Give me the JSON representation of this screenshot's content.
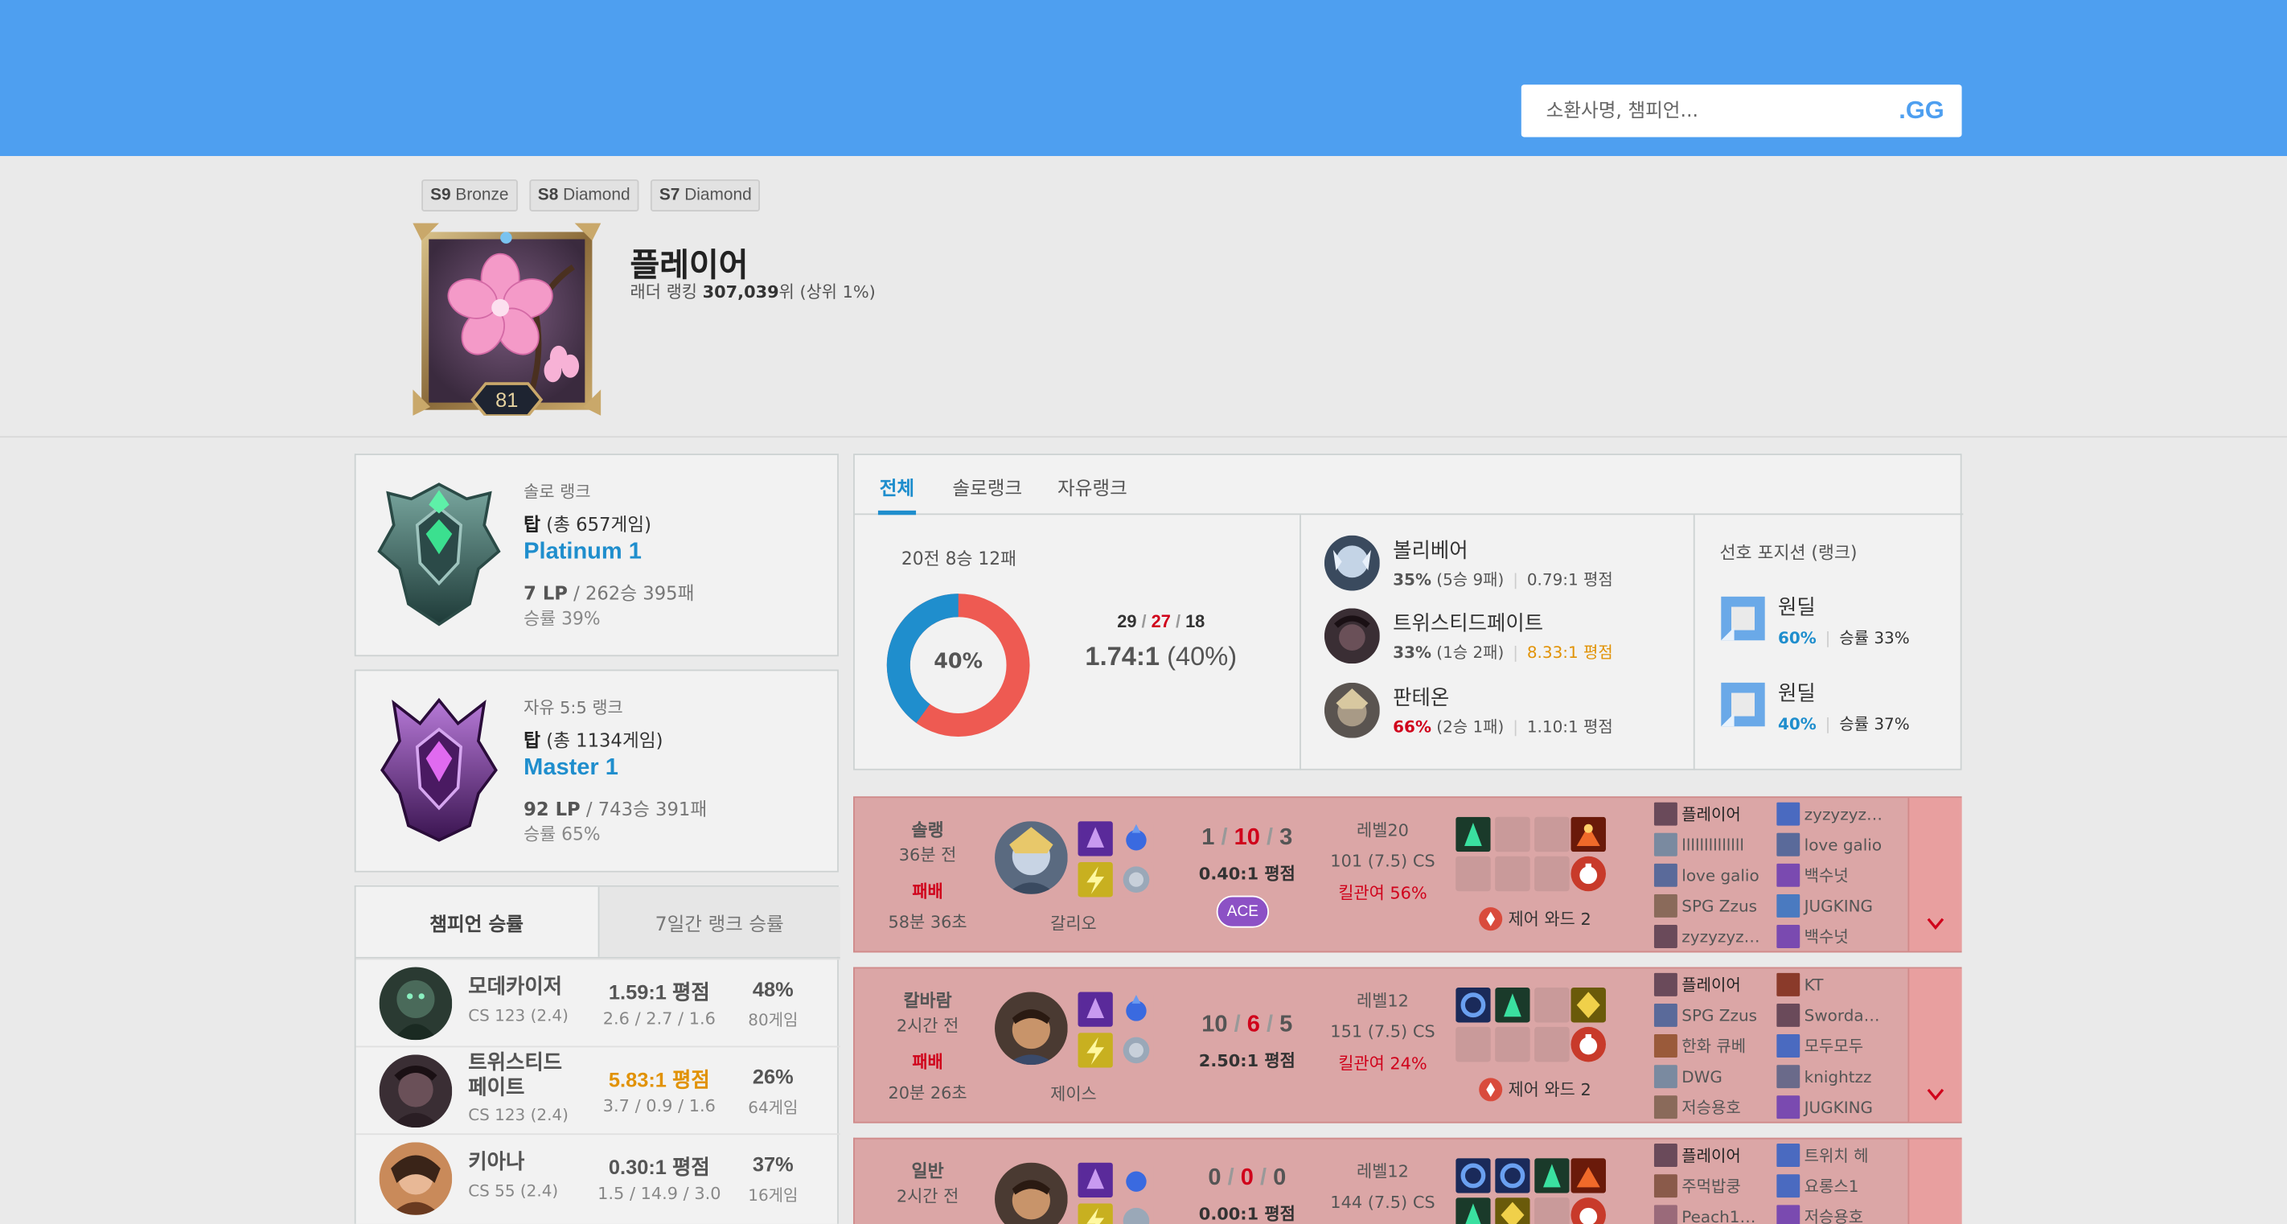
{
  "search": {
    "placeholder": "소환사명, 챔피언...",
    "logo": ".GG"
  },
  "profile": {
    "past_tiers": [
      {
        "season": "S9",
        "tier": "Bronze"
      },
      {
        "season": "S8",
        "tier": "Diamond"
      },
      {
        "season": "S7",
        "tier": "Diamond"
      }
    ],
    "level": "81",
    "name": "플레이어",
    "ladder_prefix": "래더 랭킹 ",
    "ladder_rank": "307,039",
    "ladder_suffix": "위 (상위 1%)"
  },
  "solo_rank": {
    "label": "솔로 랭크",
    "position": "탑",
    "games": " (총 657게임)",
    "tier": "Platinum 1",
    "lp": "7 LP",
    "record": " / 262승 395패",
    "winrate": "승률 39%"
  },
  "flex_rank": {
    "label": "자유 5:5 랭크",
    "position": "탑",
    "games": " (총 1134게임)",
    "tier": "Master 1",
    "lp": "92 LP",
    "record": " / 743승 391패",
    "winrate": "승률 65%"
  },
  "champ_stats": {
    "tabs": [
      "챔피언 승률",
      "7일간 랭크 승률"
    ],
    "rows": [
      {
        "name": "모데카이저",
        "cs": "CS 123 (2.4)",
        "kda": "1.59:1 평점",
        "kda_detail": "2.6 / 2.7 / 1.6",
        "winrate": "48%",
        "games": "80게임"
      },
      {
        "name": "트위스티드\n페이트",
        "name1": "트위스티드",
        "name2": "페이트",
        "cs": "CS 123 (2.4)",
        "kda": "5.83:1 평점",
        "kda_detail": "3.7 / 0.9 / 1.6",
        "winrate": "26%",
        "games": "64게임"
      },
      {
        "name": "키아나",
        "cs": "CS 55 (2.4)",
        "kda": "0.30:1 평점",
        "kda_detail": "1.5 / 14.9 / 3.0",
        "winrate": "37%",
        "games": "16게임"
      }
    ]
  },
  "summary": {
    "tabs": [
      "전체",
      "솔로랭크",
      "자유랭크"
    ],
    "record": "20전 8승 12패",
    "winrate_label": "40%",
    "winrate": 0.4,
    "kills": "29",
    "deaths": "27",
    "assists": "18",
    "kda": "1.74:1",
    "kda_pct": " (40%)",
    "champions": [
      {
        "name": "볼리베어",
        "wr": "35%",
        "games": " (5승 9패)",
        "kda": "0.79:1 평점",
        "wr_color": "#333",
        "kda_color": "#555"
      },
      {
        "name": "트위스티드페이트",
        "wr": "33%",
        "games": " (1승 2패)",
        "kda": "8.33:1 평점",
        "wr_color": "#333",
        "kda_color": "#e19205"
      },
      {
        "name": "판테온",
        "wr": "66%",
        "games": " (2승 1패)",
        "kda": "1.10:1 평점",
        "wr_color": "#d0021b",
        "kda_color": "#555"
      }
    ],
    "position_title": "선호 포지션 (랭크)",
    "positions": [
      {
        "name": "원딜",
        "pick": "60%",
        "wr": "승률 33%"
      },
      {
        "name": "원딜",
        "pick": "40%",
        "wr": "승률 37%"
      }
    ]
  },
  "games": [
    {
      "type": "솔랭",
      "ago": "36분 전",
      "result": "패배",
      "duration": "58분 36초",
      "champion": "갈리오",
      "k": "1",
      "d": "10",
      "a": "3",
      "ratio": "0.40:1 평점",
      "badge": "ACE",
      "level": "레벨20",
      "cs": "101 (7.5) CS",
      "kp": "킬관여 56%",
      "ward": "제어 와드 2",
      "team1": [
        "플레이어",
        "llllllllllllll",
        "love galio",
        "SPG Zzus",
        "zyzyzyz…"
      ],
      "team2": [
        "zyzyzyz…",
        "love galio",
        "백수넛",
        "JUGKING",
        "백수넛"
      ]
    },
    {
      "type": "칼바람",
      "ago": "2시간 전",
      "result": "패배",
      "duration": "20분 26초",
      "champion": "제이스",
      "k": "10",
      "d": "6",
      "a": "5",
      "ratio": "2.50:1 평점",
      "level": "레벨12",
      "cs": "151 (7.5) CS",
      "kp": "킬관여 24%",
      "ward": "제어 와드 2",
      "team1": [
        "플레이어",
        "SPG Zzus",
        "한화 큐베",
        "DWG",
        "저승용호"
      ],
      "team2": [
        "KT",
        "Sworda…",
        "모두모두",
        "knightzz",
        "JUGKING"
      ]
    },
    {
      "type": "일반",
      "ago": "2시간 전",
      "champion": "제이스",
      "k": "0",
      "d": "0",
      "a": "0",
      "ratio": "0.00:1 평점",
      "level": "레벨12",
      "cs": "144 (7.5) CS",
      "team1": [
        "플레이어",
        "주먹밥쿵",
        "Peach1…"
      ],
      "team2": [
        "트위치 헤",
        "요롱스1",
        "저승용호"
      ]
    }
  ],
  "colors": {
    "header": "#4e9ff0",
    "accent": "#1f8ecd",
    "loss_bg": "#dba6a6",
    "red": "#d0021b",
    "orange": "#e19205"
  }
}
